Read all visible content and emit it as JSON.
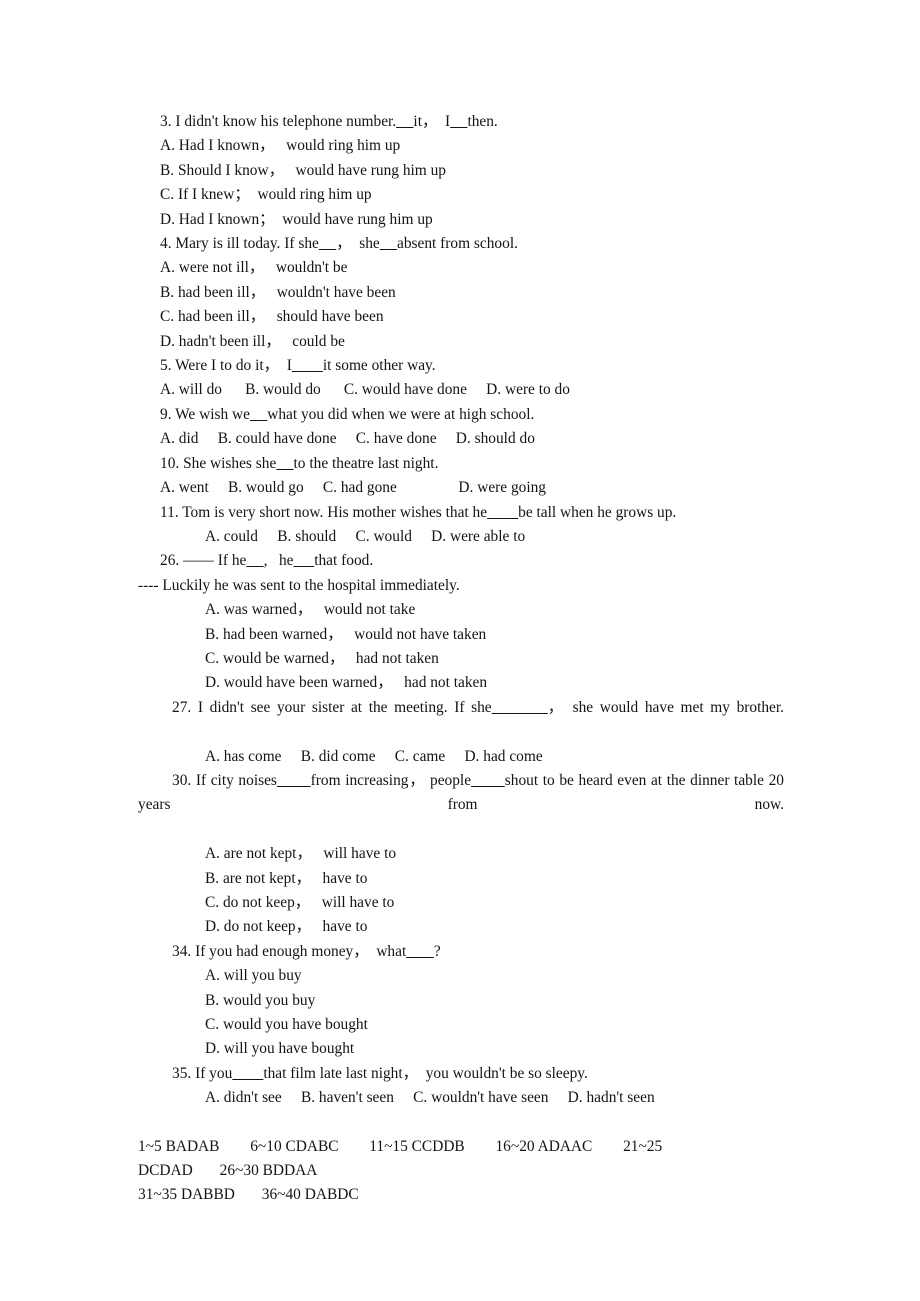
{
  "document": {
    "type": "grammar-worksheet",
    "subject": "English subjunctive mood multiple-choice exercises",
    "background_color": "#ffffff",
    "text_color": "#141414"
  },
  "questions": [
    {
      "number": "3",
      "stem": "3. I didn't know his telephone number._____it，  I_____then.",
      "options": [
        "A. Had I known，   would ring him up",
        "B. Should I know，   would have rung him up",
        "C. If I knew；  would ring him up",
        "D. Had I known；  would have rung him up"
      ]
    },
    {
      "number": "4",
      "stem": "4. Mary is ill today. If she_____，  she_____absent from school.",
      "options": [
        "A. were not ill，   wouldn't be",
        "B. had been ill，   wouldn't have been",
        "C. had been ill，   should have been",
        "D. hadn't been ill，   could be"
      ]
    },
    {
      "number": "5",
      "stem": "5. Were I to do it，  I_________it some other way.",
      "options": [
        "A. will do      B. would do      C. would have done     D. were to do"
      ]
    },
    {
      "number": "9",
      "stem": "9. We wish we_____what you did when we were at high school.",
      "options": [
        "A. did     B. could have done     C. have done     D. should do"
      ]
    },
    {
      "number": "10",
      "stem": "10. She wishes she_____to the theatre last night.",
      "options": [
        "A. went     B. would go     C. had gone                D. were going"
      ]
    },
    {
      "number": "11",
      "stem": "11. Tom is very short now. His mother wishes that he_________be tall when he grows up.",
      "options": [
        "A. could     B. should     C. would     D. were able to"
      ]
    },
    {
      "number": "26",
      "stem": "26. —— If he_____,   he______that food.",
      "stem_line2": "---- Luckily he was sent to the hospital immediately.",
      "options": [
        "A. was warned，   would not take",
        "B. had been warned，   would not have taken",
        "C. would be warned，   had not taken",
        "D. would have been warned，   had not taken"
      ]
    },
    {
      "number": "27",
      "stem": "27. I didn't see your sister at the meeting. If she_________，  she would have met my brother.",
      "options": [
        "A. has come     B. did come     C. came     D. had come"
      ]
    },
    {
      "number": "30",
      "stem": "30. If city noises________from increasing，  people________shout to be heard even at the dinner table 20 years from now.",
      "options": [
        "A. are not kept，   will have to",
        "B. are not kept，   have to",
        "C. do not keep，   will have to",
        "D. do not keep，   have to"
      ]
    },
    {
      "number": "34",
      "stem": "34. If you had enough money，  what________?",
      "options": [
        "A. will you buy",
        "B. would you buy",
        "C. would you have bought",
        "D. will you have bought"
      ]
    },
    {
      "number": "35",
      "stem": "35. If you_________that film late last night，  you wouldn't be so sleepy.",
      "options": [
        "A. didn't see     B. haven't seen     C. wouldn't have seen     D. hadn't seen"
      ]
    }
  ],
  "answer_key": {
    "line1": "1~5 BADAB        6~10 CDABC        11~15 CCDDB        16~20 ADAAC        21~25",
    "line2": "DCDAD       26~30 BDDAA",
    "line3": "31~35 DABBD       36~40 DABDC",
    "ranges": [
      {
        "range": "1~5",
        "answers": "BADAB"
      },
      {
        "range": "6~10",
        "answers": "CDABC"
      },
      {
        "range": "11~15",
        "answers": "CCDDB"
      },
      {
        "range": "16~20",
        "answers": "ADAAC"
      },
      {
        "range": "21~25",
        "answers": "DCDAD"
      },
      {
        "range": "26~30",
        "answers": "BDDAA"
      },
      {
        "range": "31~35",
        "answers": "DABBD"
      },
      {
        "range": "36~40",
        "answers": "DABDC"
      }
    ]
  }
}
